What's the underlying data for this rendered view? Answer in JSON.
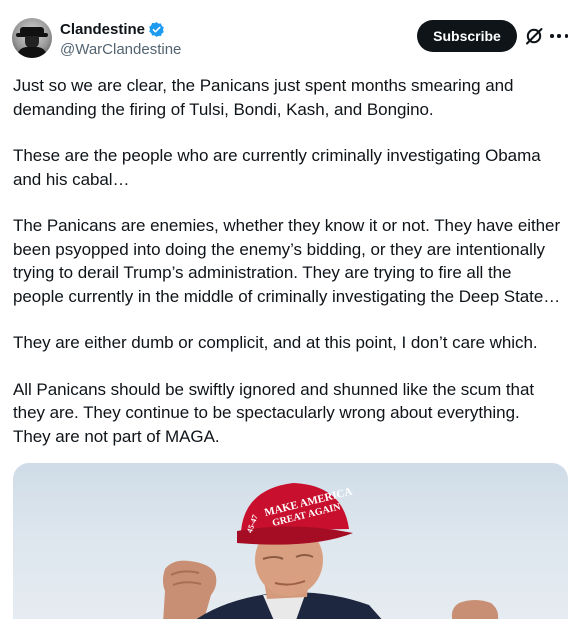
{
  "author": {
    "display_name": "Clandestine",
    "handle": "@WarClandestine",
    "verified_color": "#1d9bf0"
  },
  "actions": {
    "subscribe_label": "Subscribe",
    "grok_icon": "grok-slash-icon",
    "more_icon": "more-dots-icon"
  },
  "tweet": {
    "paragraphs": [
      [
        "Just so we are clear, the Panicans just spent months smearing and",
        "demanding the firing of Tulsi, Bondi, Kash, and Bongino."
      ],
      [
        "These are the people who are currently criminally investigating Obama",
        "and his cabal…"
      ],
      [
        "The Panicans are enemies, whether they know it or not. They have either",
        "been psyopped into doing the enemy’s bidding, or they are intentionally",
        "trying to derail Trump’s administration. They are trying to fire all the",
        "people currently in the middle of criminally investigating the Deep State…"
      ],
      [
        "They are either dumb or complicit, and at this point, I don’t care which."
      ],
      [
        "All Panicans should be swiftly ignored and shunned like the scum that",
        "they are. They continue to be spectacularly wrong about everything.",
        "They are not part of MAGA."
      ]
    ]
  },
  "media": {
    "hat_text_line1": "MAKE AMERICA",
    "hat_text_line2": "GREAT AGAIN",
    "hat_side_text": "45-47",
    "hat_color": "#c8102e"
  }
}
